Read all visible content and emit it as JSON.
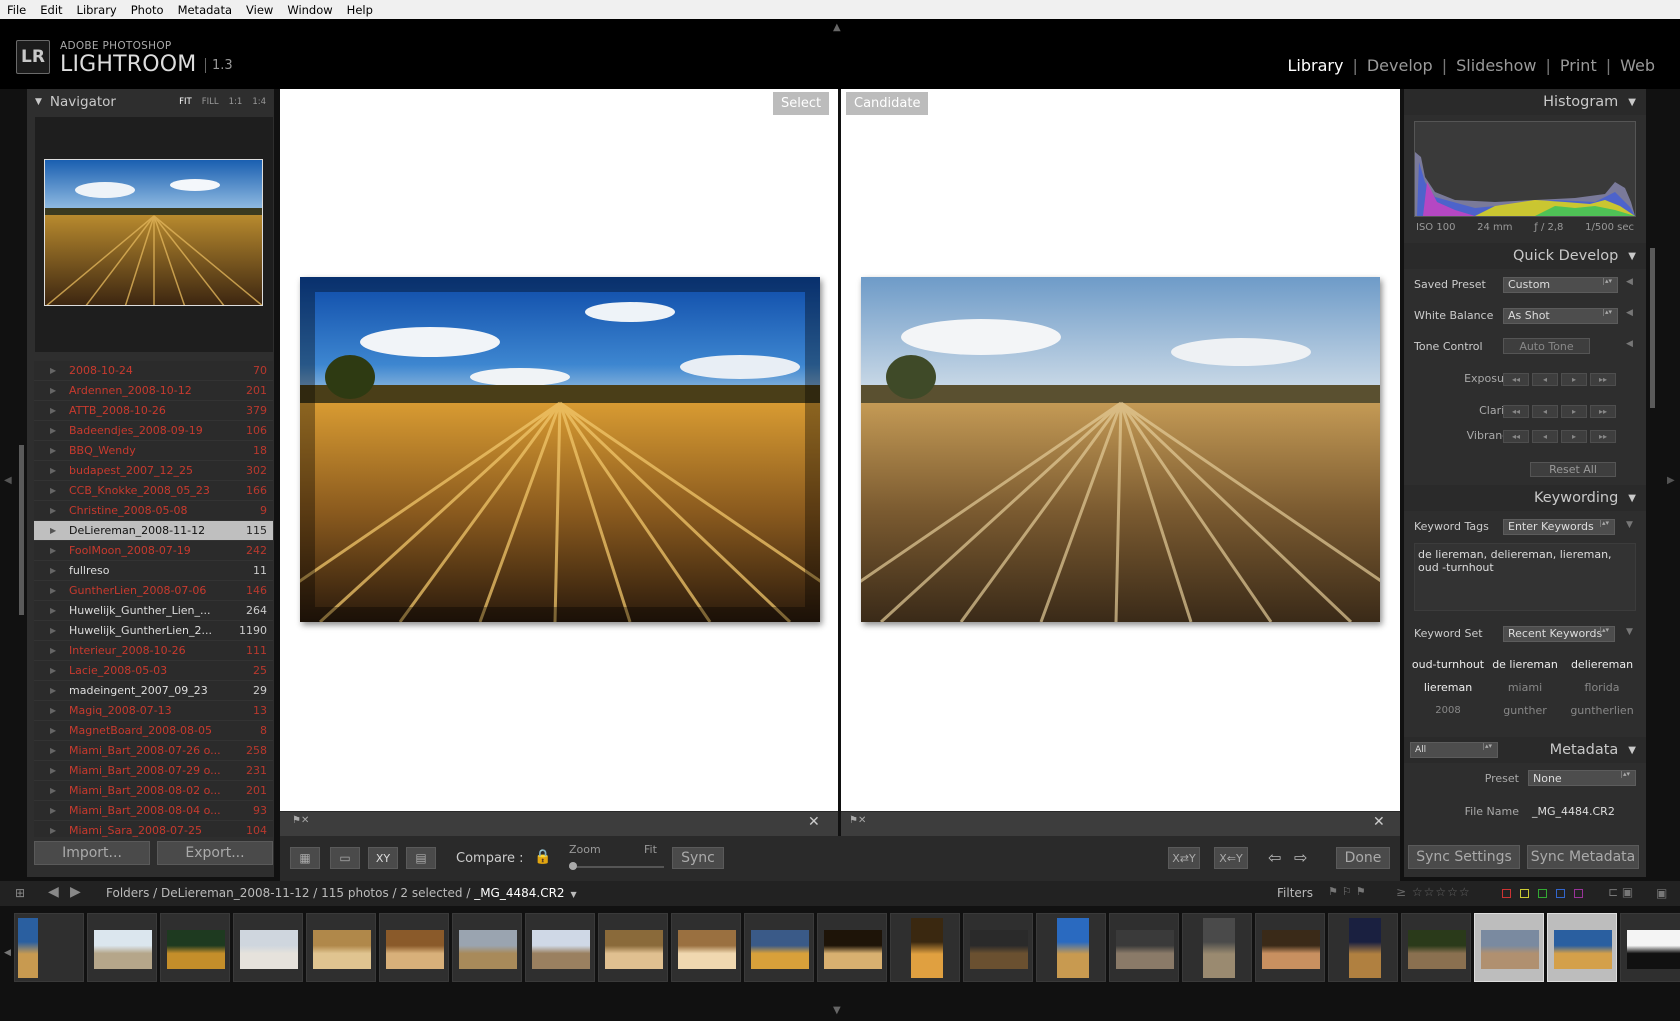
{
  "menu": [
    "File",
    "Edit",
    "Library",
    "Photo",
    "Metadata",
    "View",
    "Window",
    "Help"
  ],
  "identity": {
    "logo": "LR",
    "brand": "ADOBE PHOTOSHOP",
    "product": "LIGHTROOM",
    "version": "1.3"
  },
  "modules": [
    {
      "label": "Library",
      "active": true
    },
    {
      "label": "Develop"
    },
    {
      "label": "Slideshow"
    },
    {
      "label": "Print"
    },
    {
      "label": "Web"
    }
  ],
  "navigator": {
    "title": "Navigator",
    "zoom_options": [
      "FIT",
      "FILL",
      "1:1",
      "1:4"
    ]
  },
  "folders": [
    {
      "name": "2008-10-24",
      "count": "70",
      "state": "red"
    },
    {
      "name": "Ardennen_2008-10-12",
      "count": "201",
      "state": "red"
    },
    {
      "name": "ATTB_2008-10-26",
      "count": "379",
      "state": "red"
    },
    {
      "name": "Badeendjes_2008-09-19",
      "count": "106",
      "state": "red"
    },
    {
      "name": "BBQ_Wendy",
      "count": "18",
      "state": "red"
    },
    {
      "name": "budapest_2007_12_25",
      "count": "302",
      "state": "red"
    },
    {
      "name": "CCB_Knokke_2008_05_23",
      "count": "166",
      "state": "red"
    },
    {
      "name": "Christine_2008-05-08",
      "count": "9",
      "state": "red"
    },
    {
      "name": "DeLiereman_2008-11-12",
      "count": "115",
      "state": "sel"
    },
    {
      "name": "FoolMoon_2008-07-19",
      "count": "242",
      "state": "red"
    },
    {
      "name": "fullreso",
      "count": "11",
      "state": "white"
    },
    {
      "name": "GuntherLien_2008-07-06",
      "count": "146",
      "state": "red"
    },
    {
      "name": "Huwelijk_Gunther_Lien_...",
      "count": "264",
      "state": "white"
    },
    {
      "name": "Huwelijk_GuntherLien_2...",
      "count": "1190",
      "state": "white"
    },
    {
      "name": "Interieur_2008-10-26",
      "count": "111",
      "state": "red"
    },
    {
      "name": "Lacie_2008-05-03",
      "count": "25",
      "state": "red"
    },
    {
      "name": "madeingent_2007_09_23",
      "count": "29",
      "state": "white"
    },
    {
      "name": "Magiq_2008-07-13",
      "count": "13",
      "state": "red"
    },
    {
      "name": "MagnetBoard_2008-08-05",
      "count": "8",
      "state": "red"
    },
    {
      "name": "Miami_Bart_2008-07-26 o...",
      "count": "258",
      "state": "red"
    },
    {
      "name": "Miami_Bart_2008-07-29 o...",
      "count": "231",
      "state": "red"
    },
    {
      "name": "Miami_Bart_2008-08-02 o...",
      "count": "201",
      "state": "red"
    },
    {
      "name": "Miami_Bart_2008-08-04 o...",
      "count": "93",
      "state": "red"
    },
    {
      "name": "Miami_Sara_2008-07-25",
      "count": "104",
      "state": "red"
    }
  ],
  "left_buttons": {
    "import": "Import...",
    "export": "Export..."
  },
  "compare": {
    "select_label": "Select",
    "candidate_label": "Candidate"
  },
  "toolbar": {
    "compare_label": "Compare :",
    "zoom_label": "Zoom",
    "fit_label": "Fit",
    "sync_label": "Sync",
    "done_label": "Done"
  },
  "right_buttons": {
    "sync_settings": "Sync Settings",
    "sync_metadata": "Sync Metadata"
  },
  "histogram": {
    "title": "Histogram",
    "iso": "ISO 100",
    "focal": "24 mm",
    "aperture": "ƒ / 2,8",
    "shutter": "1/500 sec"
  },
  "quick_develop": {
    "title": "Quick Develop",
    "saved_preset_label": "Saved Preset",
    "saved_preset_value": "Custom",
    "white_balance_label": "White Balance",
    "white_balance_value": "As Shot",
    "tone_control_label": "Tone Control",
    "auto_tone": "Auto Tone",
    "exposure": "Exposure",
    "clarity": "Clarity",
    "vibrance": "Vibrance",
    "reset_all": "Reset All"
  },
  "keywording": {
    "title": "Keywording",
    "tags_label": "Keyword Tags",
    "tags_mode": "Enter Keywords",
    "keywords_text": "de liereman, deliereman, liereman, oud -turnhout",
    "set_label": "Keyword Set",
    "set_value": "Recent Keywords",
    "grid": [
      [
        "oud-turnhout",
        "de liereman",
        "deliereman"
      ],
      [
        "liereman",
        "miami",
        "florida"
      ],
      [
        "2008",
        "gunther",
        "guntherlien"
      ]
    ]
  },
  "metadata": {
    "title": "Metadata",
    "filter": "All",
    "preset_label": "Preset",
    "preset_value": "None",
    "filename_label": "File Name",
    "filename_value": "_MG_4484.CR2"
  },
  "filmstrip": {
    "breadcrumb": "Folders / DeLiereman_2008-11-12 / 115 photos / 2 selected / ",
    "current_file": "_MG_4484.CR2",
    "filters_label": "Filters"
  },
  "colors": {
    "accent_red": "#c83a2e",
    "panel": "#2e2e2e",
    "selected": "#bfbfbf"
  }
}
